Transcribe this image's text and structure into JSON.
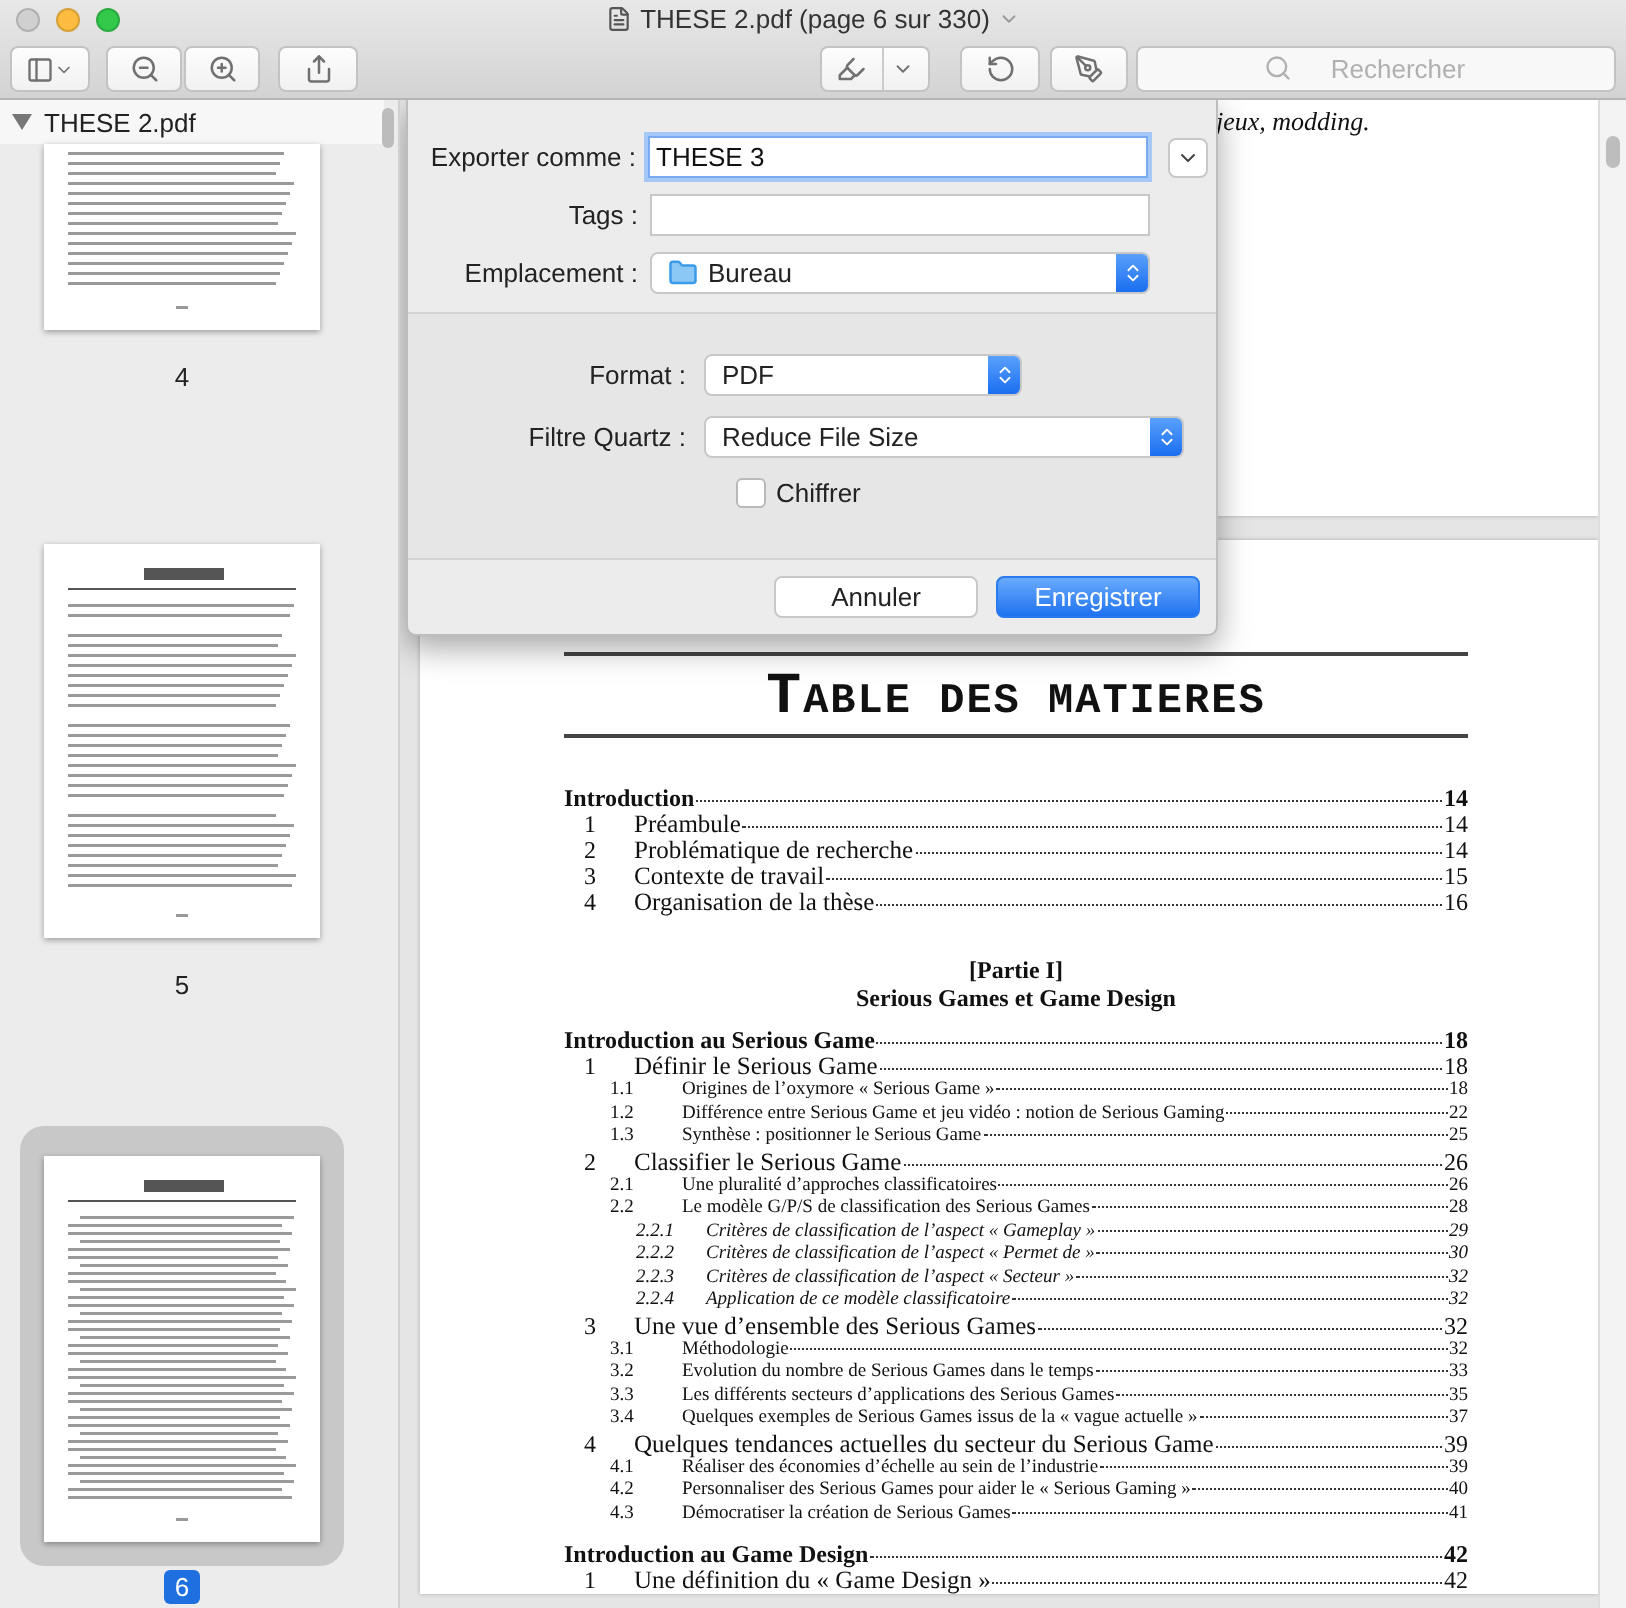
{
  "window": {
    "title": "THESE 2.pdf (page 6 sur 330)"
  },
  "toolbar": {
    "search": {
      "placeholder": "Rechercher"
    }
  },
  "sidebar": {
    "document": {
      "label": "THESE 2.pdf",
      "expanded": true
    },
    "pages": [
      {
        "label": "4",
        "selected": false
      },
      {
        "label": "5",
        "selected": false
      },
      {
        "label": "6",
        "selected": true
      }
    ]
  },
  "document": {
    "previous_page_text": "jeux, modding.",
    "toc": {
      "title": "TABLE DES MATIERES",
      "entries": [
        {
          "kind": "chapter",
          "title": "Introduction",
          "page": "14"
        },
        {
          "kind": "section",
          "number": "1",
          "title": "Préambule",
          "page": "14"
        },
        {
          "kind": "section",
          "number": "2",
          "title": "Problématique de recherche",
          "page": "14"
        },
        {
          "kind": "section",
          "number": "3",
          "title": "Contexte de travail",
          "page": "15"
        },
        {
          "kind": "section",
          "number": "4",
          "title": "Organisation de la thèse",
          "page": "16"
        },
        {
          "kind": "part",
          "label": "[Partie I]",
          "title": "Serious Games et Game Design"
        },
        {
          "kind": "chapter",
          "title": "Introduction au Serious Game",
          "page": "18"
        },
        {
          "kind": "section",
          "number": "1",
          "title": "Définir le Serious Game",
          "page": "18"
        },
        {
          "kind": "subsection",
          "number": "1.1",
          "title": "Origines de l’oxymore « Serious Game »",
          "page": "18"
        },
        {
          "kind": "subsection",
          "number": "1.2",
          "title": "Différence entre Serious Game et jeu vidéo : notion de Serious Gaming",
          "page": "22"
        },
        {
          "kind": "subsection",
          "number": "1.3",
          "title": "Synthèse : positionner le Serious Game",
          "page": "25"
        },
        {
          "kind": "section",
          "number": "2",
          "title": "Classifier le Serious Game",
          "page": "26"
        },
        {
          "kind": "subsection",
          "number": "2.1",
          "title": "Une pluralité d’approches classificatoires",
          "page": "26"
        },
        {
          "kind": "subsection",
          "number": "2.2",
          "title": "Le modèle G/P/S de classification des Serious Games",
          "page": "28"
        },
        {
          "kind": "subsubsection",
          "number": "2.2.1",
          "title": "Critères de classification de l’aspect « Gameplay »",
          "page": "29"
        },
        {
          "kind": "subsubsection",
          "number": "2.2.2",
          "title": "Critères de classification de l’aspect « Permet de »",
          "page": "30"
        },
        {
          "kind": "subsubsection",
          "number": "2.2.3",
          "title": "Critères de classification de l’aspect « Secteur »",
          "page": "32"
        },
        {
          "kind": "subsubsection",
          "number": "2.2.4",
          "title": "Application de ce modèle classificatoire",
          "page": "32"
        },
        {
          "kind": "section",
          "number": "3",
          "title": "Une vue d’ensemble des Serious Games",
          "page": "32"
        },
        {
          "kind": "subsection",
          "number": "3.1",
          "title": "Méthodologie",
          "page": "32"
        },
        {
          "kind": "subsection",
          "number": "3.2",
          "title": "Evolution du nombre de Serious Games dans le temps",
          "page": "33"
        },
        {
          "kind": "subsection",
          "number": "3.3",
          "title": "Les différents secteurs d’applications des Serious Games",
          "page": "35"
        },
        {
          "kind": "subsection",
          "number": "3.4",
          "title": "Quelques exemples de Serious Games issus de la « vague actuelle »",
          "page": "37"
        },
        {
          "kind": "section",
          "number": "4",
          "title": "Quelques tendances actuelles du secteur du Serious Game",
          "page": "39"
        },
        {
          "kind": "subsection",
          "number": "4.1",
          "title": "Réaliser des économies d’échelle au sein de l’industrie",
          "page": "39"
        },
        {
          "kind": "subsection",
          "number": "4.2",
          "title": "Personnaliser des Serious Games pour aider le « Serious Gaming »",
          "page": "40"
        },
        {
          "kind": "subsection",
          "number": "4.3",
          "title": "Démocratiser la création de Serious Games",
          "page": "41"
        },
        {
          "kind": "chapter",
          "title": "Introduction au Game Design",
          "page": "42"
        },
        {
          "kind": "section",
          "number": "1",
          "title": "Une définition du « Game Design »",
          "page": "42"
        }
      ]
    }
  },
  "export_dialog": {
    "export_as": {
      "label": "Exporter comme :",
      "value": "THESE 3"
    },
    "tags": {
      "label": "Tags :"
    },
    "location": {
      "label": "Emplacement :",
      "value": "Bureau"
    },
    "format": {
      "label": "Format :",
      "value": "PDF"
    },
    "quartz_filter": {
      "label": "Filtre Quartz :",
      "value": "Reduce File Size"
    },
    "encrypt": {
      "label": "Chiffrer",
      "checked": false
    },
    "buttons": [
      {
        "label": "Annuler",
        "kind": "cancel"
      },
      {
        "label": "Enregistrer",
        "kind": "default"
      }
    ]
  }
}
